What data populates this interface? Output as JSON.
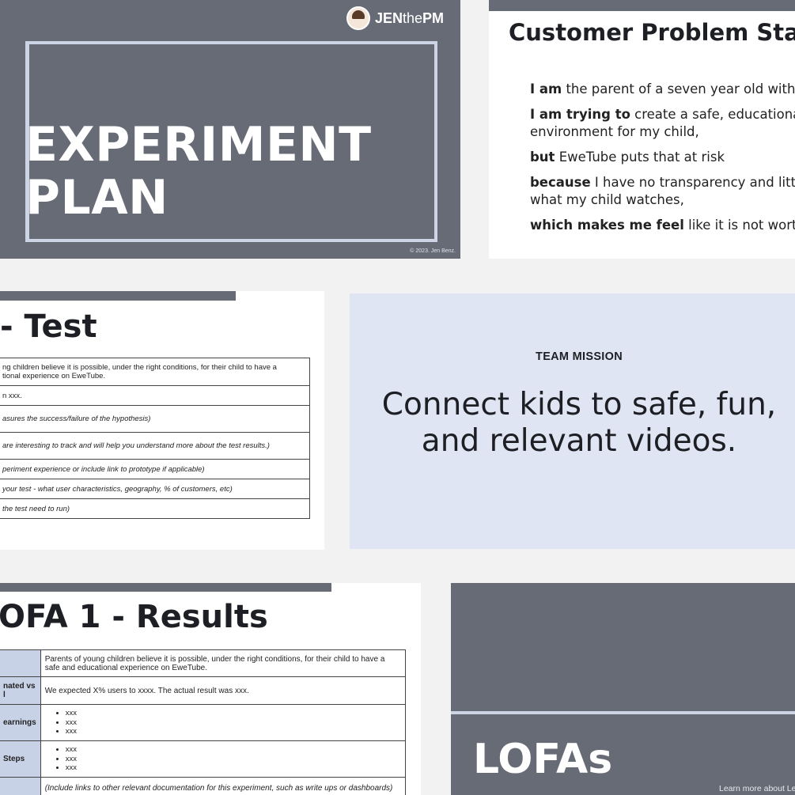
{
  "slide1": {
    "logo_jen": "JEN",
    "logo_the": "the",
    "logo_pm": "PM",
    "title_line1": "EXPERIMENT",
    "title_line2": "PLAN",
    "copyright": "© 2023. Jen Benz."
  },
  "slide2": {
    "title": "Customer Problem Statem",
    "lines": [
      {
        "bold": "I am",
        "rest": " the parent of a seven year old with an iP"
      },
      {
        "bold": "I am trying to",
        "rest": " create a safe, educational, and"
      },
      {
        "bold": "",
        "rest": "environment for my child,"
      },
      {
        "bold": "but",
        "rest": " EweTube puts that at risk"
      },
      {
        "bold": "because",
        "rest": " I have no transparency and little co"
      },
      {
        "bold": "",
        "rest": "what my child watches,"
      },
      {
        "bold": "which makes me feel",
        "rest": " like it is not worth the"
      }
    ]
  },
  "slide3": {
    "title": "- Test",
    "rows": [
      "ng children believe it is possible, under the right conditions, for their child to have a\ntional experience on EweTube.",
      "n xxx.",
      "asures the success/failure of the hypothesis)",
      "are interesting to track and will help you understand more about the test results.)",
      "periment experience or include link to prototype if applicable)",
      "your test - what user characteristics, geography, % of customers, etc)",
      "the test need to run)"
    ]
  },
  "slide4": {
    "label": "TEAM MISSION",
    "mission_line1": "Connect kids to safe, fun,",
    "mission_line2": "and relevant videos."
  },
  "slide5": {
    "title": "OFA 1 - Results",
    "rows": [
      {
        "header": "",
        "text": "Parents of young children believe it is possible, under the right conditions, for their child to have a safe and educational experience on EweTube."
      },
      {
        "header": "nated vs\nl",
        "text": "We expected X% users to xxxx. The actual result was xxx."
      },
      {
        "header": "earnings",
        "bullets": [
          "xxx",
          "xxx",
          "xxx"
        ]
      },
      {
        "header": "Steps",
        "bullets": [
          "xxx",
          "xxx",
          "xxx"
        ]
      },
      {
        "header": "",
        "text": "(Include links to other relevant documentation for this experiment, such as write ups or dashboards)"
      }
    ]
  },
  "slide6": {
    "title": "LOFAs",
    "learn_more": "Learn more about Le"
  }
}
